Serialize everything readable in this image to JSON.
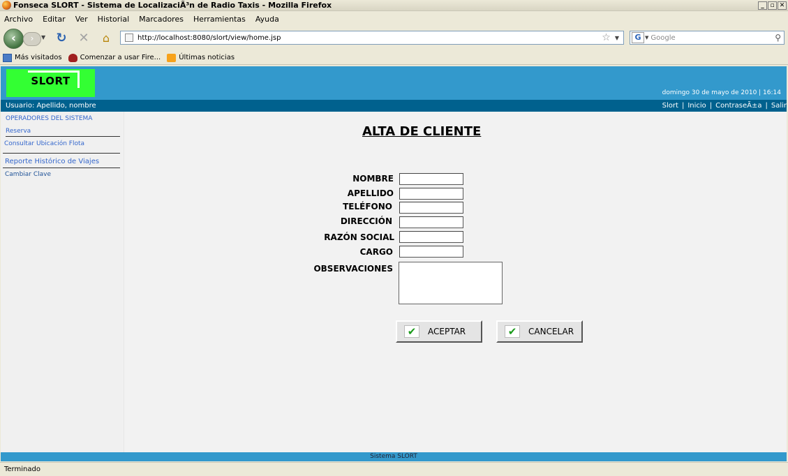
{
  "window": {
    "title": "Fonseca SLORT - Sistema de LocalizaciÃ³n de Radio Taxis - Mozilla Firefox",
    "controls": [
      "_",
      "▫",
      "✕"
    ]
  },
  "menu": [
    "Archivo",
    "Editar",
    "Ver",
    "Historial",
    "Marcadores",
    "Herramientas",
    "Ayuda"
  ],
  "nav": {
    "url": "http://localhost:8080/slort/view/home.jsp",
    "search_placeholder": "Google"
  },
  "bookmarks": [
    {
      "label": "Más visitados",
      "icon": "most-visited-icon"
    },
    {
      "label": "Comenzar a usar Fire...",
      "icon": "firefox-icon"
    },
    {
      "label": "Últimas noticias",
      "icon": "rss-icon"
    }
  ],
  "app": {
    "logo": "SLORT",
    "datetime": "domingo 30 de mayo de 2010 | 16:14",
    "user": "Usuario: Apellido, nombre",
    "top_links": [
      "Slort",
      "Inicio",
      "ContraseÃ±a",
      "Salir"
    ],
    "sidebar": [
      "OPERADORES DEL SISTEMA",
      "Reserva",
      "Consultar Ubicación Flota",
      "Reporte Histórico de Viajes",
      "Cambiar Clave"
    ],
    "footer": "Sistema SLORT"
  },
  "form": {
    "title": "ALTA DE CLIENTE",
    "fields": [
      "NOMBRE",
      "APELLIDO",
      "TELÉFONO",
      "DIRECCIÓN",
      "RAZÓN SOCIAL",
      "CARGO"
    ],
    "observations_label": "OBSERVACIONES",
    "accept": "ACEPTAR",
    "cancel": "CANCELAR"
  },
  "status": "Terminado"
}
